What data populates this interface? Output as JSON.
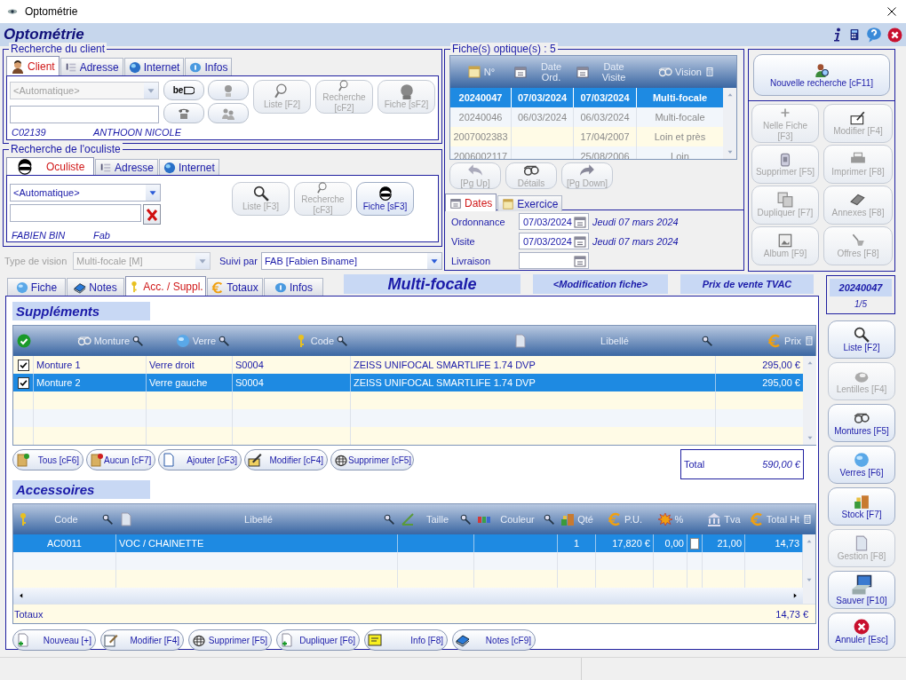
{
  "window": {
    "title": "Optométrie"
  },
  "header": {
    "title": "Optométrie"
  },
  "client_search": {
    "title": "Recherche du client",
    "tabs": [
      {
        "label": "Client",
        "selected": true
      },
      {
        "label": "Adresse",
        "selected": false
      },
      {
        "label": "Internet",
        "selected": false
      },
      {
        "label": "Infos",
        "selected": false
      }
    ],
    "select": {
      "value": "<Automatique>",
      "disabled": true
    },
    "id_card_label": "be",
    "buttons": [
      {
        "label": "Liste [F2]",
        "disabled": true
      },
      {
        "label": "Recherche [cF2]",
        "disabled": true
      },
      {
        "label": "Fiche [sF2]",
        "disabled": true
      }
    ],
    "code": "C02139",
    "name": "ANTHOON NICOLE"
  },
  "oculist_search": {
    "title": "Recherche de l'oculiste",
    "tabs": [
      {
        "label": "Oculiste",
        "selected": true
      },
      {
        "label": "Adresse",
        "selected": false
      },
      {
        "label": "Internet",
        "selected": false
      }
    ],
    "select": {
      "value": "<Automatique>",
      "disabled": false
    },
    "buttons": [
      {
        "label": "Liste [F3]",
        "disabled": true
      },
      {
        "label": "Recherche [cF3]",
        "disabled": true
      },
      {
        "label": "Fiche [sF3]",
        "disabled": false
      }
    ],
    "code": "FABIEN BIN",
    "name": "Fab"
  },
  "vision_type": {
    "label": "Type de vision",
    "value": "Multi-focale [M]",
    "disabled": true
  },
  "followed_by": {
    "label": "Suivi par",
    "value": "FAB [Fabien Biname]",
    "disabled": false
  },
  "records": {
    "title": "Fiche(s) optique(s) : 5",
    "columns": [
      "N°",
      "Date Ord.",
      "Date Visite",
      "Vision"
    ],
    "rows": [
      {
        "number": "20240047",
        "date_ord": "07/03/2024",
        "date_visit": "07/03/2024",
        "vision": "Multi-focale",
        "selected": true
      },
      {
        "number": "20240046",
        "date_ord": "06/03/2024",
        "date_visit": "06/03/2024",
        "vision": "Multi-focale",
        "selected": false
      },
      {
        "number": "2007002383",
        "date_visit": "17/04/2007",
        "vision": "Loin et près",
        "selected": false
      },
      {
        "number": "2006002117",
        "date_visit": "25/08/2006",
        "vision": "Loin",
        "selected": false
      }
    ],
    "buttons": [
      {
        "label": "[Pg Up]",
        "disabled": true
      },
      {
        "label": "Détails",
        "disabled": true
      },
      {
        "label": "[Pg Down]",
        "disabled": true
      }
    ]
  },
  "date_tabs": [
    {
      "label": "Dates",
      "selected": true
    },
    {
      "label": "Exercice",
      "selected": false
    }
  ],
  "dates": [
    {
      "label": "Ordonnance",
      "value": "07/03/2024",
      "long_date": "Jeudi 07 mars 2024"
    },
    {
      "label": "Visite",
      "value": "07/03/2024",
      "long_date": "Jeudi 07 mars 2024"
    },
    {
      "label": "Livraison"
    }
  ],
  "new_search": {
    "label": "Nouvelle recherche [cF11]",
    "disabled": false
  },
  "record_actions": [
    {
      "label": "Nelle Fiche [F3]",
      "disabled": true
    },
    {
      "label": "Modifier [F4]",
      "disabled": true
    },
    {
      "label": "Supprimer [F5]",
      "disabled": true
    },
    {
      "label": "Imprimer [F8]",
      "disabled": true
    },
    {
      "label": "Dupliquer [F7]",
      "disabled": true
    },
    {
      "label": "Annexes [F8]",
      "disabled": true
    },
    {
      "label": "Album [F9]",
      "disabled": true
    },
    {
      "label": "Offres [F8]",
      "disabled": true
    }
  ],
  "detail_tabs": [
    {
      "label": "Fiche",
      "selected": false
    },
    {
      "label": "Notes",
      "selected": false
    },
    {
      "label": "Acc. / Suppl.",
      "selected": true
    },
    {
      "label": "Totaux",
      "selected": false
    },
    {
      "label": "Infos",
      "selected": false
    }
  ],
  "vision_title": "Multi-focale",
  "mode": "<Modification fiche>",
  "price_mode": "Prix de vente TVAC",
  "record_badge": {
    "number": "20240047",
    "position": "1/5"
  },
  "supplements": {
    "title": "Suppléments",
    "columns": [
      "Monture",
      "Verre",
      "Code",
      "Libellé",
      "Prix"
    ],
    "rows": [
      {
        "checked": true,
        "frame": "Monture 1",
        "lens": "Verre droit",
        "code": "S0004",
        "label": "ZEISS UNIFOCAL SMARTLIFE 1.74 DVP",
        "price": "295,00 €",
        "selected": false
      },
      {
        "checked": true,
        "frame": "Monture 2",
        "lens": "Verre gauche",
        "code": "S0004",
        "label": "ZEISS UNIFOCAL SMARTLIFE 1.74 DVP",
        "price": "295,00 €",
        "selected": true
      }
    ],
    "buttons": [
      {
        "label": "Tous [cF6]"
      },
      {
        "label": "Aucun [cF7]"
      },
      {
        "label": "Ajouter [cF3]"
      },
      {
        "label": "Modifier [cF4]"
      },
      {
        "label": "Supprimer [cF5]"
      }
    ],
    "total_label": "Total",
    "total": "590,00 €"
  },
  "accessories": {
    "title": "Accessoires",
    "columns": [
      "Code",
      "Libellé",
      "Taille",
      "Couleur",
      "Qté",
      "P.U.",
      "%",
      "Tva",
      "Total Ht"
    ],
    "rows": [
      {
        "code": "AC0011",
        "label": "VOC / CHAINETTE",
        "qty": "1",
        "unit_price": "17,820 €",
        "discount": "0,00",
        "flag": false,
        "vat": "21,00",
        "total": "14,73",
        "selected": true
      }
    ],
    "totals_label": "Totaux",
    "total": "14,73 €",
    "buttons": [
      {
        "label": "Nouveau [+]"
      },
      {
        "label": "Modifier [F4]"
      },
      {
        "label": "Supprimer [F5]"
      },
      {
        "label": "Dupliquer [F6]"
      },
      {
        "label": "Info [F8]"
      },
      {
        "label": "Notes [cF9]"
      }
    ]
  },
  "side_buttons": [
    {
      "label": "Liste [F2]",
      "disabled": false
    },
    {
      "label": "Lentilles [F4]",
      "disabled": true
    },
    {
      "label": "Montures [F5]",
      "disabled": false
    },
    {
      "label": "Verres [F6]",
      "disabled": false
    },
    {
      "label": "Stock [F7]",
      "disabled": false
    },
    {
      "label": "Gestion [F8]",
      "disabled": true
    },
    {
      "label": "Sauver [F10]",
      "disabled": false
    },
    {
      "label": "Annuler [Esc]",
      "disabled": false
    }
  ]
}
